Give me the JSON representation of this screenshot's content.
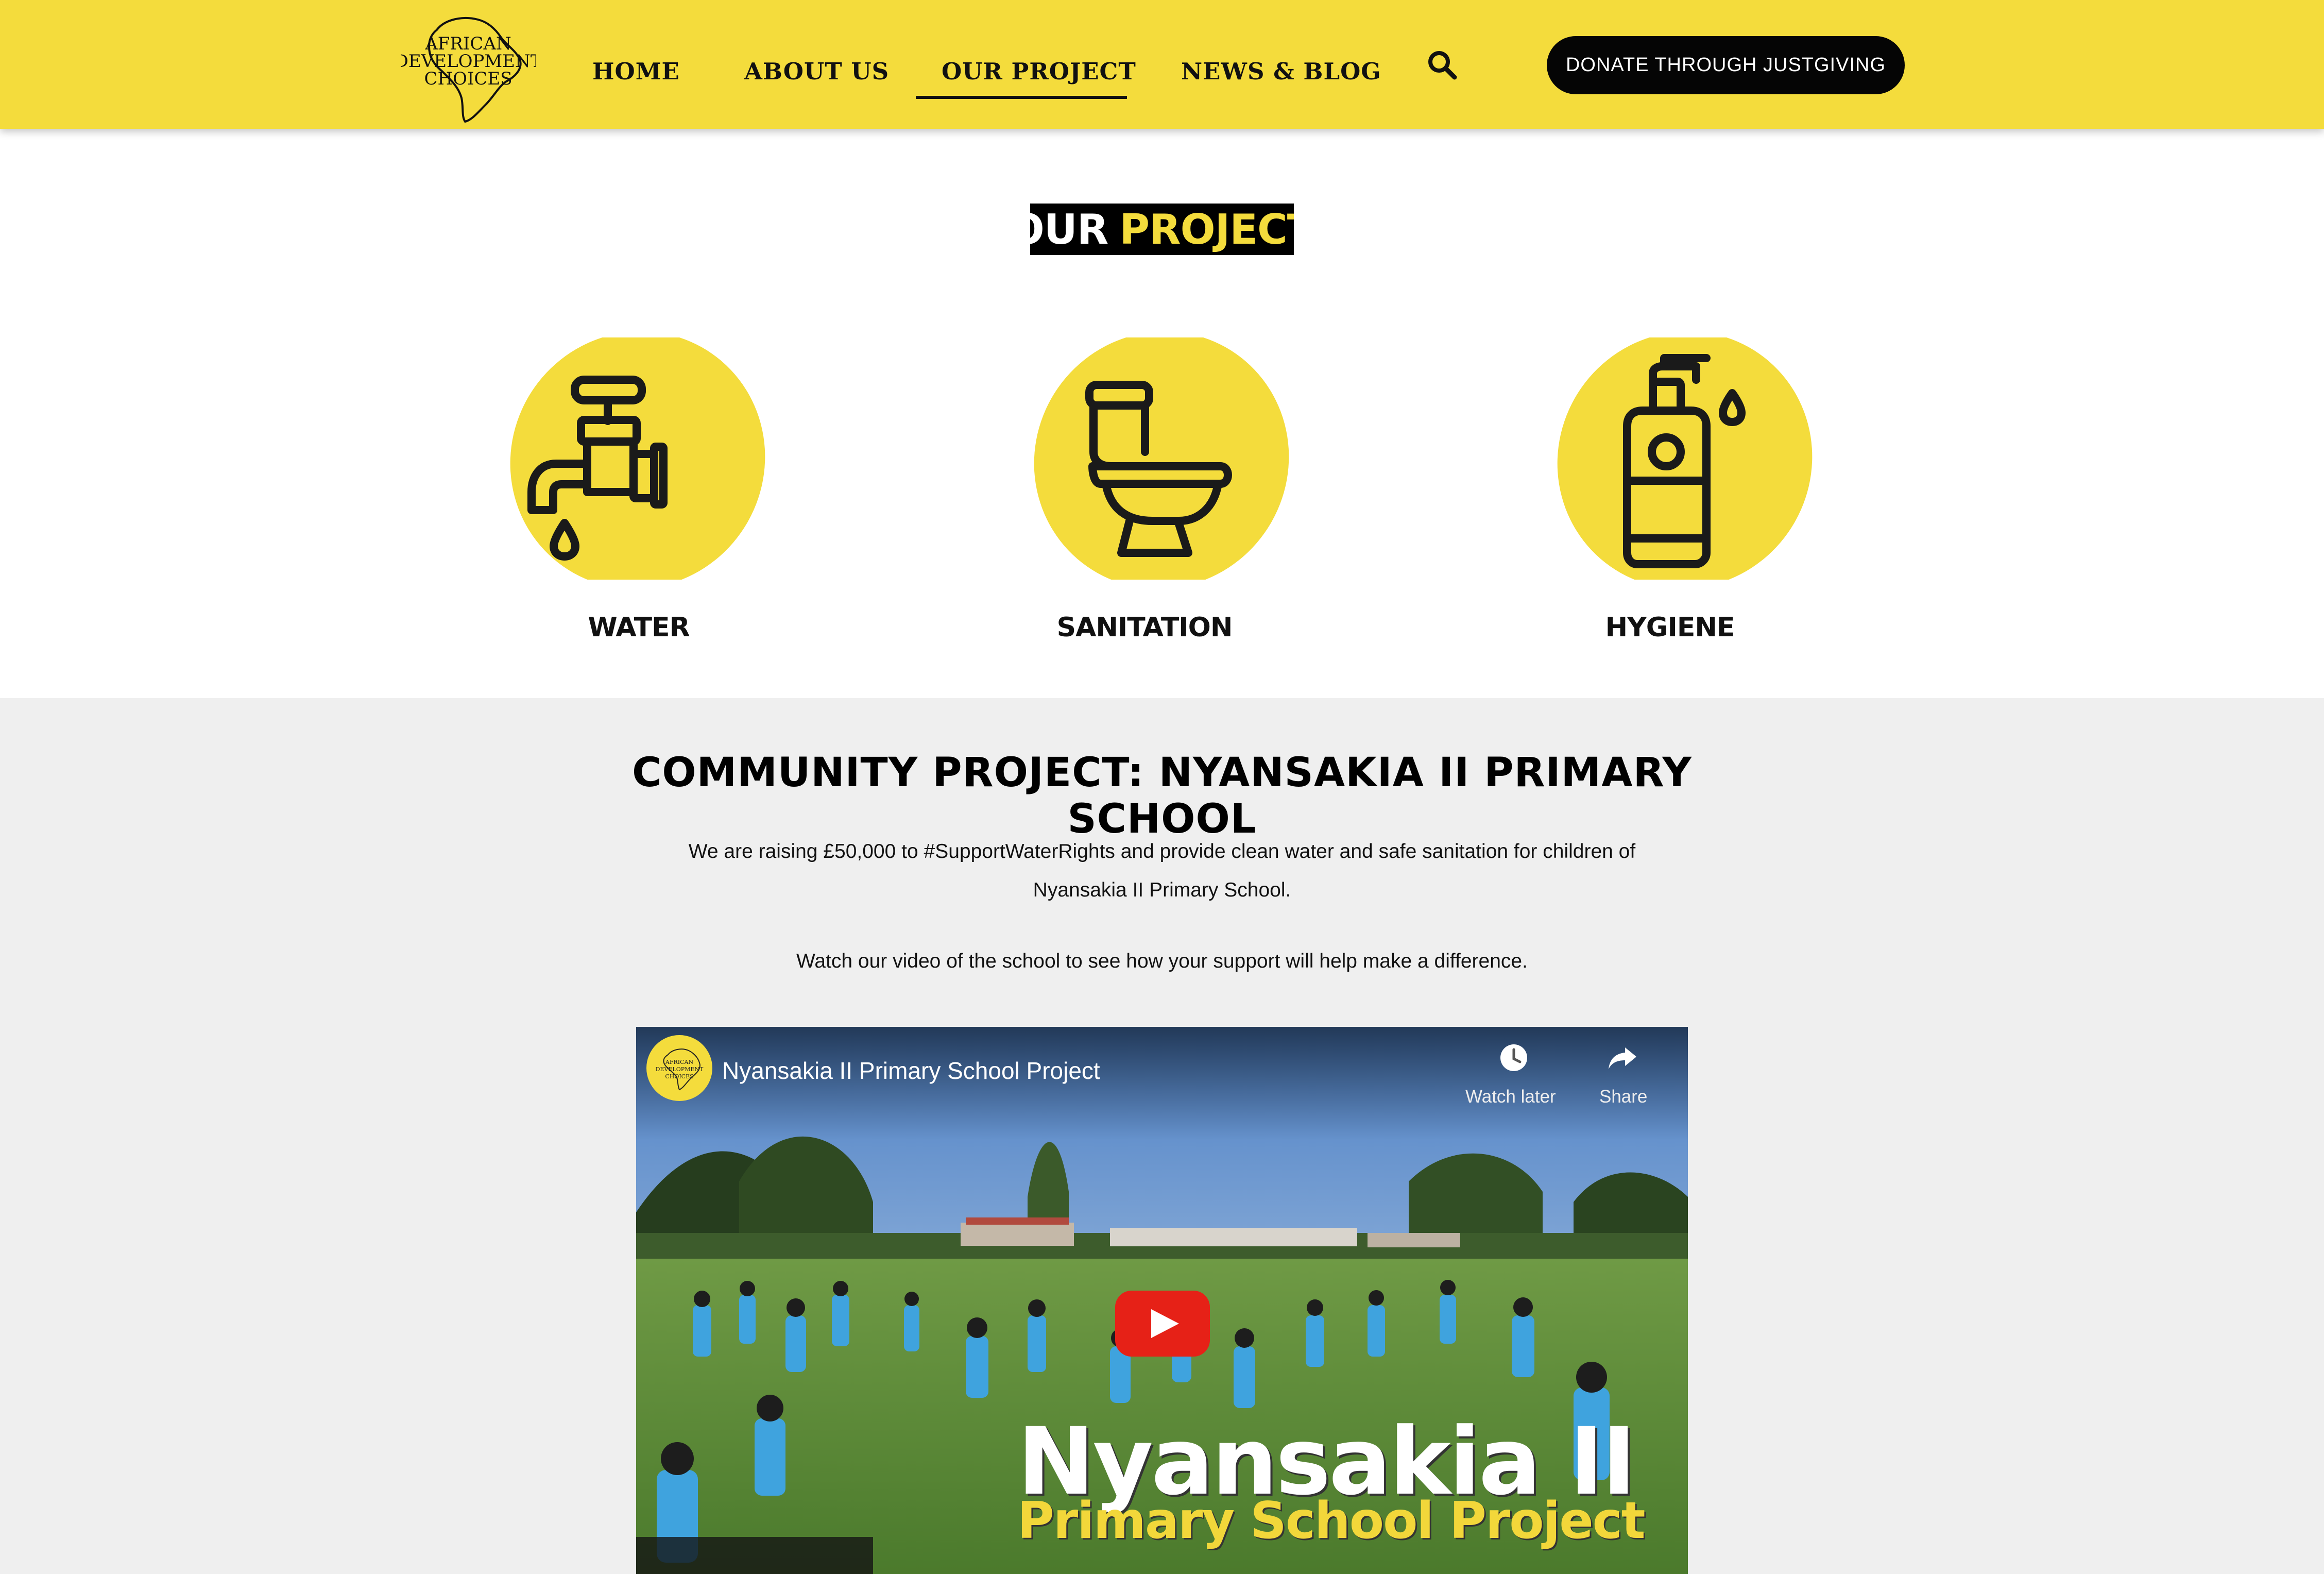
{
  "header": {
    "logo_text": [
      "AFRICAN",
      "DEVELOPMENT",
      "CHOICES"
    ],
    "nav": [
      {
        "label": "HOME"
      },
      {
        "label": "ABOUT US"
      },
      {
        "label": "OUR PROJECT",
        "active": true
      },
      {
        "label": "NEWS & BLOG"
      }
    ],
    "donate_label": "DONATE THROUGH JUSTGIVING"
  },
  "project": {
    "title_part1": "OUR",
    "title_part2": "PROJECT",
    "pillars": [
      {
        "icon": "water-tap-icon",
        "label": "WATER"
      },
      {
        "icon": "toilet-icon",
        "label": "SANITATION"
      },
      {
        "icon": "soap-dispenser-icon",
        "label": "HYGIENE"
      }
    ]
  },
  "community": {
    "heading": "COMMUNITY PROJECT: NYANSAKIA II PRIMARY SCHOOL",
    "paragraph1_line1": "We are raising £50,000 to #SupportWaterRights and provide clean water and safe sanitation for children of",
    "paragraph1_line2": "Nyansakia II Primary School.",
    "paragraph2": "Watch our video of the school to see how your support will help make a difference."
  },
  "video": {
    "title": "Nyansakia II Primary School Project",
    "watch_later_label": "Watch later",
    "share_label": "Share",
    "overlay_title": "Nyansakia II",
    "overlay_subtitle": "Primary School Project"
  },
  "colors": {
    "brand_yellow": "#f4dc3c",
    "black": "#000000",
    "section_grey": "#efefef",
    "play_red": "#e62117"
  }
}
